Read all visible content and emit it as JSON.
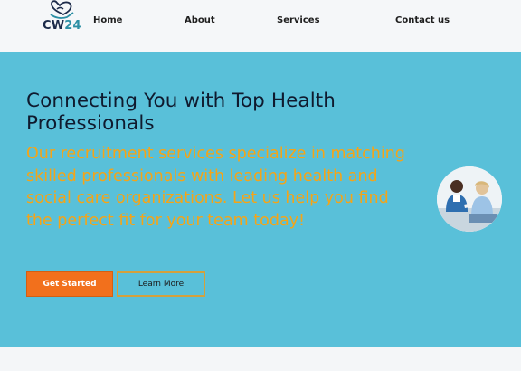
{
  "brand": {
    "logo_text_main": "CW",
    "logo_text_accent": "24"
  },
  "nav": {
    "items": [
      {
        "label": "Home"
      },
      {
        "label": "About"
      },
      {
        "label": "Services"
      },
      {
        "label": "Contact us"
      }
    ]
  },
  "hero": {
    "title": "Connecting You with Top Health Professionals",
    "subtitle": "Our recruitment services specialize in matching skilled professionals with leading health and social care organizations. Let us help you find the perfect fit for your team today!",
    "primary_button": "Get Started",
    "secondary_button": "Learn More"
  },
  "colors": {
    "hero_background": "#59c0d9",
    "title": "#0f1a2e",
    "subtitle": "#f5a417",
    "primary_button": "#f2701c",
    "secondary_button_border": "#d4a13c"
  }
}
